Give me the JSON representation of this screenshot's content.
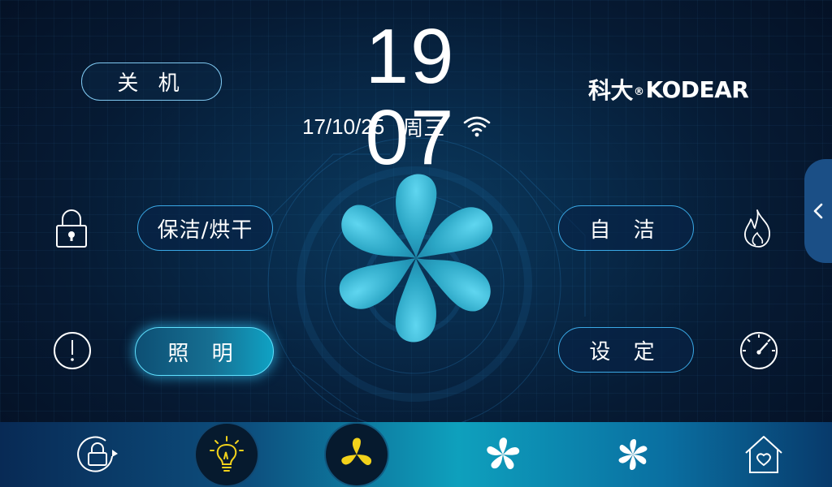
{
  "header": {
    "power_off_label": "关 机",
    "clock": "19 07",
    "date": "17/10/25",
    "weekday": "周三",
    "brand_cn": "科大",
    "brand_reg": "®",
    "brand_en": "KODEAR"
  },
  "controls": {
    "clean_dry_label": "保洁/烘干",
    "self_clean_label": "自 洁",
    "lighting_label": "照 明",
    "settings_label": "设 定"
  },
  "icons": {
    "lock": "lock-icon",
    "alert": "alert-icon",
    "flame": "flame-icon",
    "gauge": "gauge-icon",
    "wifi": "wifi-icon",
    "side_tab": "chevron-left-icon",
    "center_fan": "fan-icon"
  },
  "bottom_bar": {
    "items": [
      "lock-rotate-icon",
      "lightbulb-icon",
      "fan-3-blade-icon",
      "fan-5-blade-icon",
      "fan-6-blade-icon",
      "home-heart-icon"
    ],
    "active": [
      "lightbulb-icon",
      "fan-3-blade-icon"
    ]
  },
  "colors": {
    "accent": "#3aa9e6",
    "glow": "#5fe1ff",
    "active_icon": "#f2d21b",
    "fan": "#2aa5c4"
  }
}
